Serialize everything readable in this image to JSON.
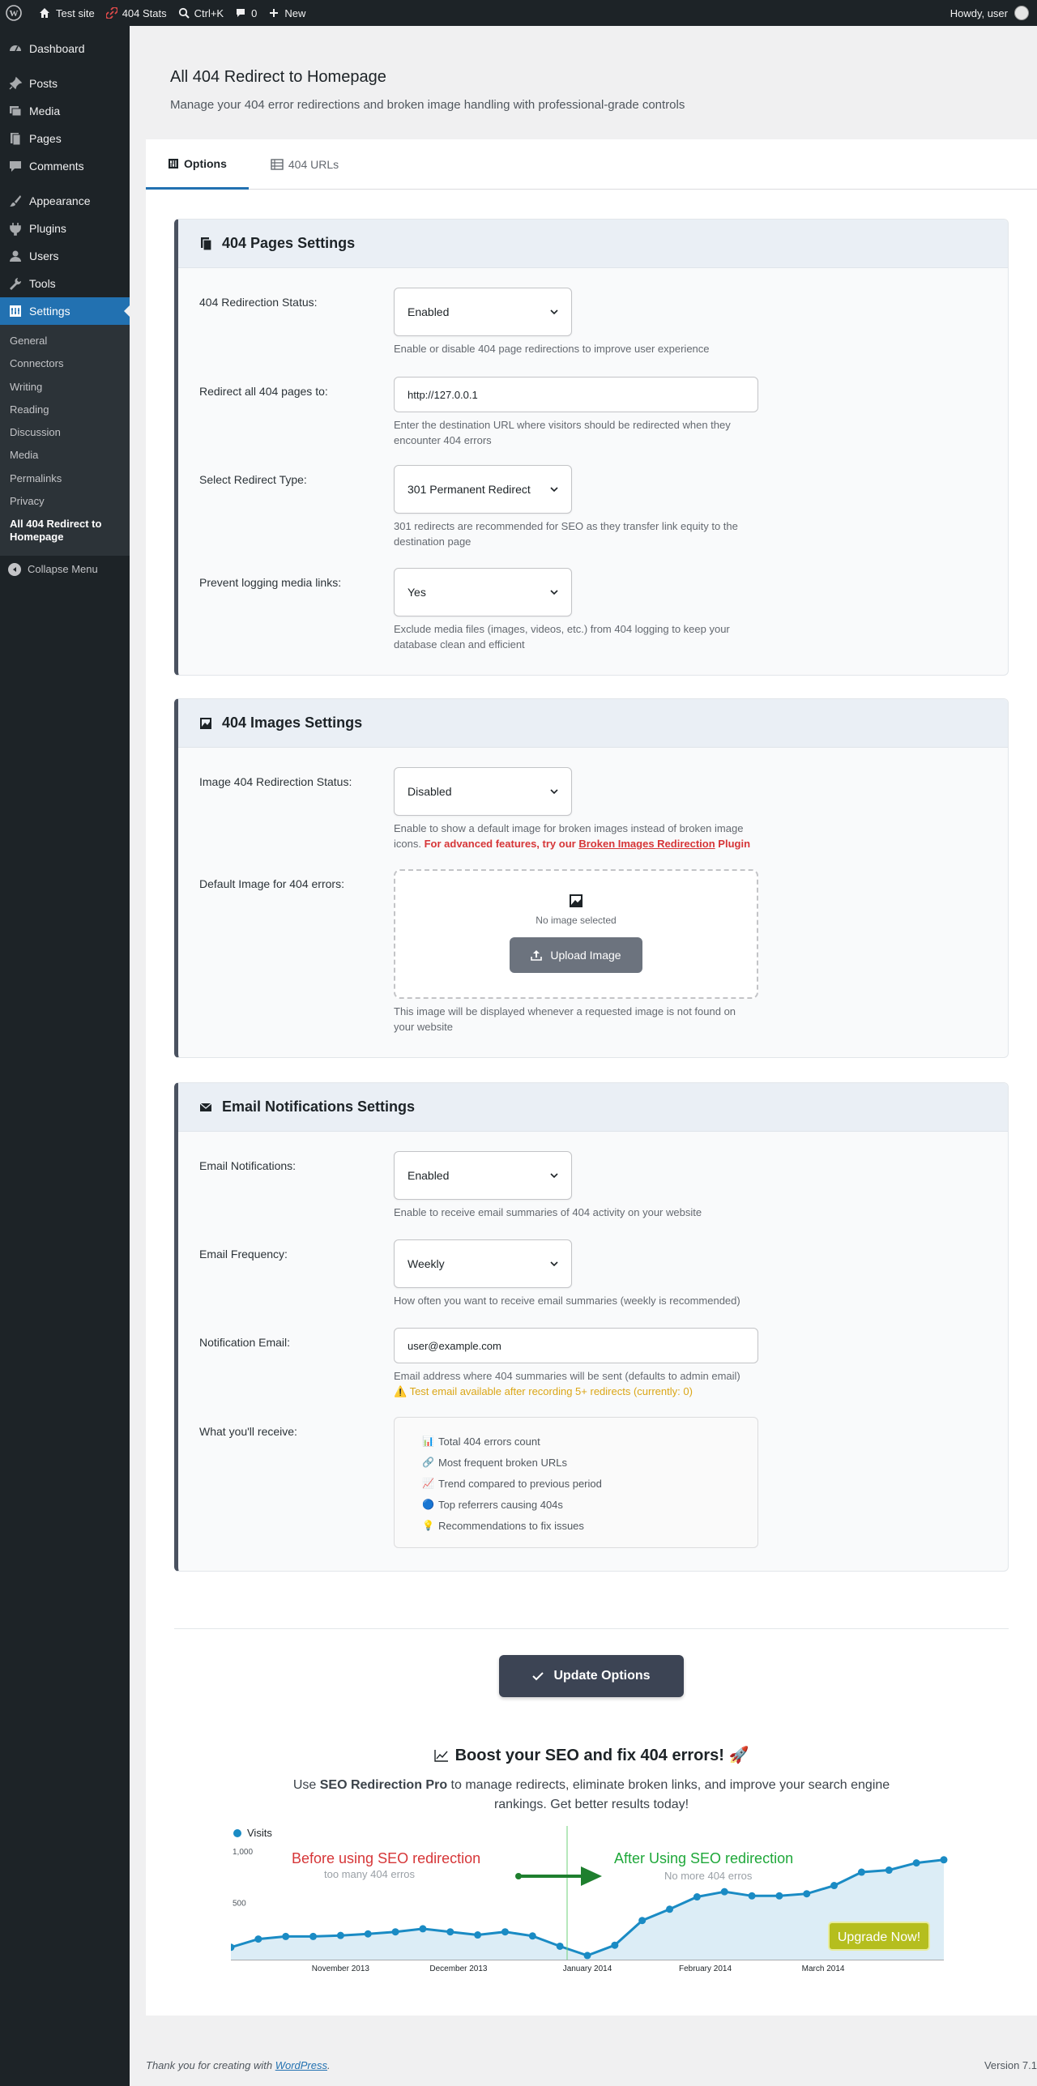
{
  "adminbar": {
    "site_name": "Test site",
    "stats": "404 Stats",
    "search_shortcut": "Ctrl+K",
    "comments_count": "0",
    "new": "New",
    "howdy": "Howdy, user"
  },
  "sidebar": {
    "items": [
      {
        "label": "Dashboard",
        "icon": "dashboard-icon"
      },
      {
        "label": "Posts",
        "icon": "pin-icon"
      },
      {
        "label": "Media",
        "icon": "media-icon"
      },
      {
        "label": "Pages",
        "icon": "pages-icon"
      },
      {
        "label": "Comments",
        "icon": "comment-icon"
      },
      {
        "label": "Appearance",
        "icon": "brush-icon"
      },
      {
        "label": "Plugins",
        "icon": "plugin-icon"
      },
      {
        "label": "Users",
        "icon": "user-icon"
      },
      {
        "label": "Tools",
        "icon": "wrench-icon"
      },
      {
        "label": "Settings",
        "icon": "settings-icon"
      }
    ],
    "submenu": [
      "General",
      "Connectors",
      "Writing",
      "Reading",
      "Discussion",
      "Media",
      "Permalinks",
      "Privacy",
      "All 404 Redirect to Homepage"
    ],
    "collapse": "Collapse Menu"
  },
  "header": {
    "title": "All 404 Redirect to Homepage",
    "subtitle": "Manage your 404 error redirections and broken image handling with professional-grade controls"
  },
  "tabs": [
    {
      "label": "Options",
      "active": true
    },
    {
      "label": "404 URLs",
      "active": false
    }
  ],
  "pages_settings": {
    "title": "404 Pages Settings",
    "status_label": "404 Redirection Status:",
    "status_value": "Enabled",
    "status_help": "Enable or disable 404 page redirections to improve user experience",
    "redirect_label": "Redirect all 404 pages to:",
    "redirect_value": "http://127.0.0.1",
    "redirect_help": "Enter the destination URL where visitors should be redirected when they encounter 404 errors",
    "type_label": "Select Redirect Type:",
    "type_value": "301 Permanent Redirect",
    "type_help": "301 redirects are recommended for SEO as they transfer link equity to the destination page",
    "media_label": "Prevent logging media links:",
    "media_value": "Yes",
    "media_help": "Exclude media files (images, videos, etc.) from 404 logging to keep your database clean and efficient"
  },
  "images_settings": {
    "title": "404 Images Settings",
    "status_label": "Image 404 Redirection Status:",
    "status_value": "Disabled",
    "status_help": "Enable to show a default image for broken images instead of broken image icons.",
    "advanced_prefix": "For advanced features, try our",
    "advanced_link": "Broken Images Redirection",
    "advanced_suffix": "Plugin",
    "default_label": "Default Image for 404 errors:",
    "no_image": "No image selected",
    "upload": "Upload Image",
    "default_help": "This image will be displayed whenever a requested image is not found on your website"
  },
  "email_settings": {
    "title": "Email Notifications Settings",
    "notif_label": "Email Notifications:",
    "notif_value": "Enabled",
    "notif_help": "Enable to receive email summaries of 404 activity on your website",
    "freq_label": "Email Frequency:",
    "freq_value": "Weekly",
    "freq_help": "How often you want to receive email summaries (weekly is recommended)",
    "email_label": "Notification Email:",
    "email_value": "user@example.com",
    "email_help": "Email address where 404 summaries will be sent (defaults to admin email)",
    "test_warning": "⚠️ Test email available after recording 5+ redirects (currently: 0)",
    "receive_label": "What you'll receive:",
    "receive_items": [
      {
        "icon": "📊",
        "text": "Total 404 errors count"
      },
      {
        "icon": "🔗",
        "text": "Most frequent broken URLs"
      },
      {
        "icon": "📈",
        "text": "Trend compared to previous period"
      },
      {
        "icon": "🔵",
        "text": "Top referrers causing 404s"
      },
      {
        "icon": "💡",
        "text": "Recommendations to fix issues"
      }
    ]
  },
  "update_button": "Update Options",
  "promo": {
    "title": "Boost your SEO and fix 404 errors! 🚀",
    "text_prefix": "Use",
    "text_bold": "SEO Redirection Pro",
    "text_suffix": "to manage redirects, eliminate broken links, and improve your search engine rankings. Get better results today!"
  },
  "chart_data": {
    "type": "line",
    "legend": "Visits",
    "y_ticks": [
      "1,000",
      "500"
    ],
    "x_labels": [
      "November 2013",
      "December 2013",
      "January 2014",
      "February 2014",
      "March 2014"
    ],
    "before_label": "Before using SEO redirection",
    "before_sub": "too many 404 erros",
    "after_label": "After Using SEO redirection",
    "after_sub": "No more 404 erros",
    "cta": "Upgrade Now!",
    "ylim": [
      0,
      1000
    ],
    "values": [
      120,
      200,
      225,
      225,
      235,
      250,
      270,
      300,
      270,
      240,
      270,
      230,
      130,
      40,
      140,
      380,
      490,
      610,
      660,
      620,
      620,
      640,
      720,
      850,
      870,
      940,
      970
    ],
    "colors": {
      "line": "#1a8bc4",
      "fill": "#dcedf6",
      "before": "#d63638",
      "after": "#1fa83a",
      "cta": "#b5be1e"
    }
  },
  "footer": {
    "thanks_prefix": "Thank you for creating with",
    "thanks_link": "WordPress",
    "version": "Version 7.1"
  }
}
